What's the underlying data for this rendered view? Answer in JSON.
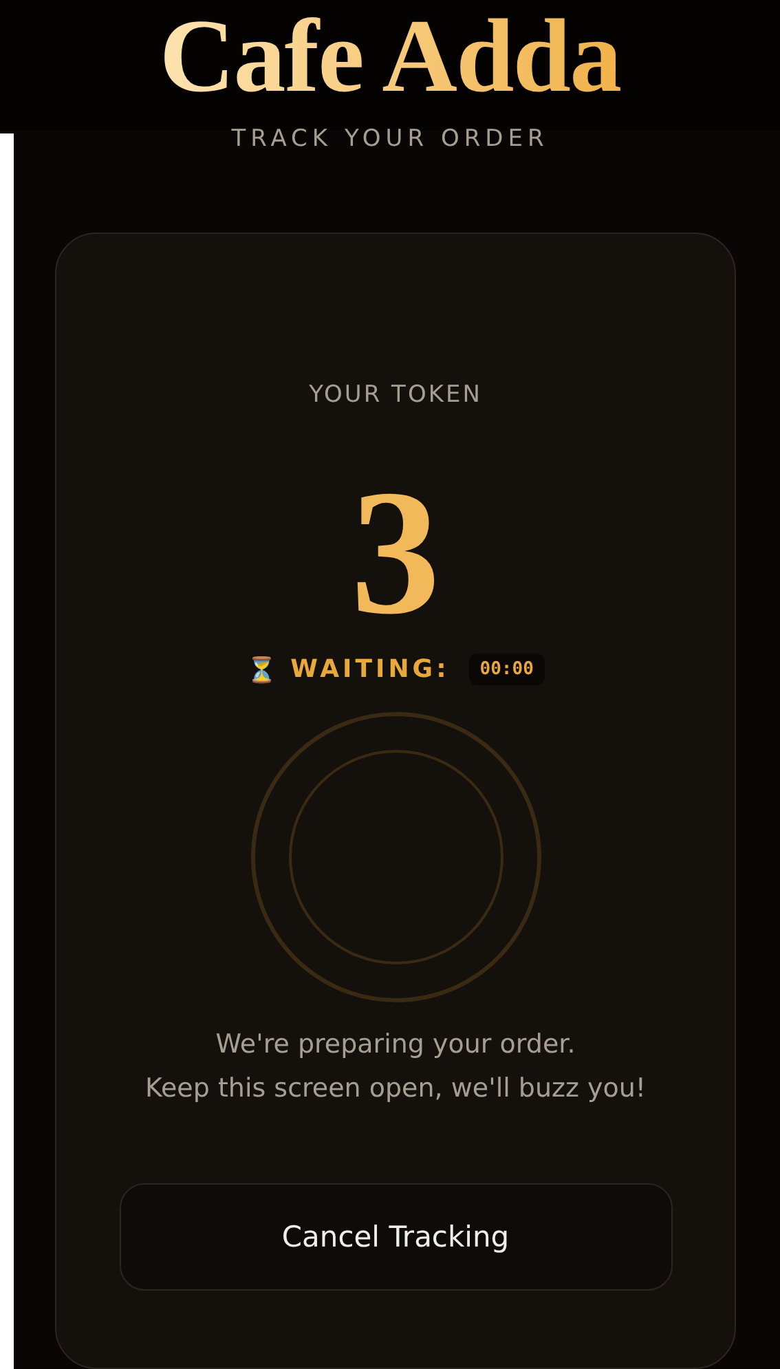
{
  "brand": {
    "title": "Cafe Adda",
    "subtitle": "TRACK YOUR ORDER"
  },
  "card": {
    "token_label": "YOUR TOKEN",
    "token": "3",
    "status_icon": "⏳",
    "status_label": "WAITING:",
    "timer": "00:00",
    "message": [
      "We're preparing your order.",
      "Keep this screen open, we'll buzz you!"
    ],
    "button": "Cancel Tracking"
  }
}
